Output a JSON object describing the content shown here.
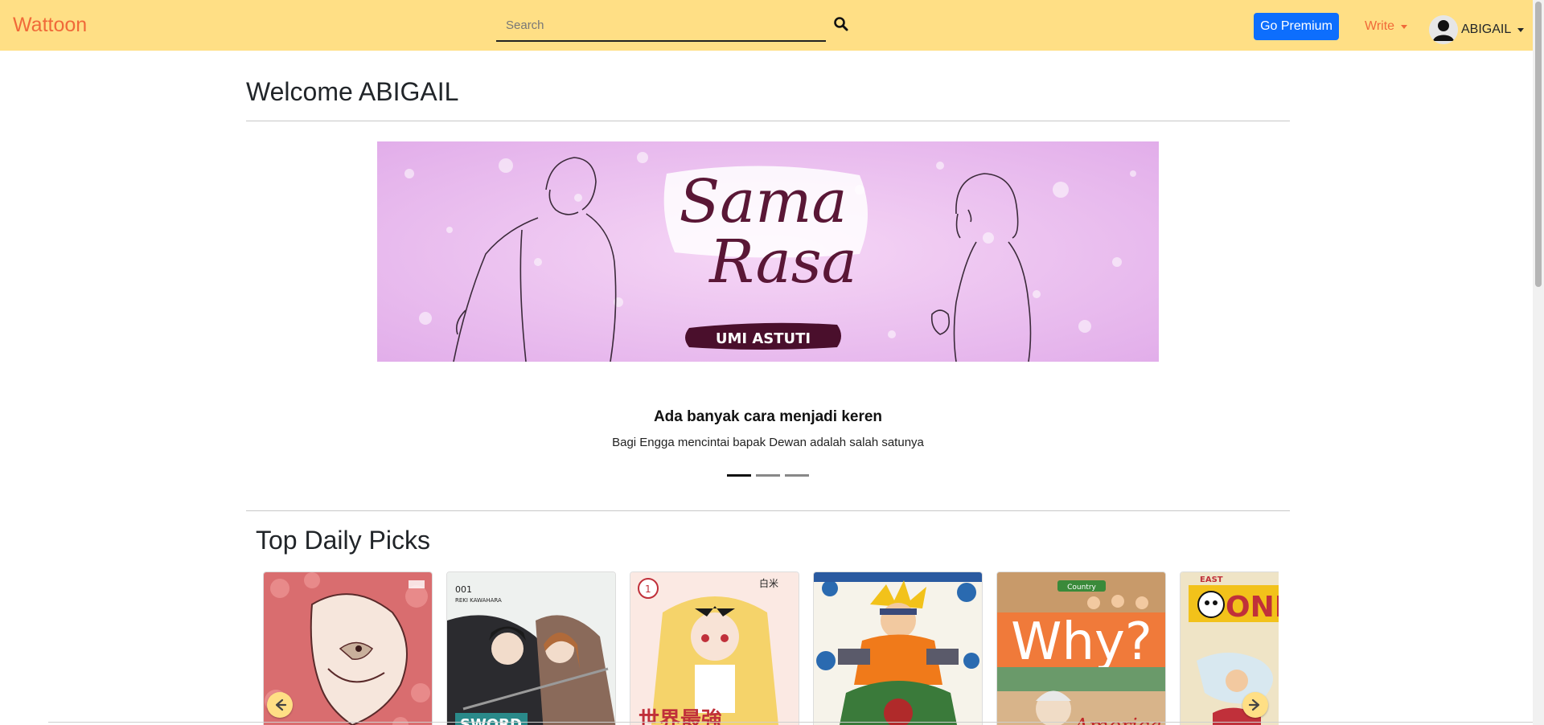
{
  "navbar": {
    "brand": "Wattoon",
    "search_placeholder": "Search",
    "premium_label": "Go Premium",
    "write_label": "Write",
    "user_name": "ABIGAIL"
  },
  "main": {
    "welcome": "Welcome ABIGAIL",
    "carousel": {
      "banner_title_line1": "Sama",
      "banner_title_line2": "Rasa",
      "banner_author": "UMI ASTUTI",
      "caption_title": "Ada banyak cara menjadi keren",
      "caption_text": "Bagi Engga mencintai bapak Dewan adalah salah satunya",
      "slides": 3,
      "active_slide": 0
    },
    "section_title": "Top Daily Picks",
    "picks": [
      {
        "id": "eagle",
        "cover_text": ""
      },
      {
        "id": "sword",
        "cover_text": "SWORD"
      },
      {
        "id": "arifureta",
        "cover_text": "世界最強"
      },
      {
        "id": "naruto",
        "cover_text": ""
      },
      {
        "id": "why",
        "cover_text": "Why?",
        "badge": "Country",
        "subtitle": "America"
      },
      {
        "id": "onepiece",
        "cover_text": "ONE P"
      }
    ]
  },
  "colors": {
    "navbar_bg": "#ffdf85",
    "brand": "#f06a39",
    "premium_bg": "#0d6efd",
    "banner_bg": "#e9b8ec"
  },
  "icons": {
    "search": "search-icon",
    "prev": "arrow-left-icon",
    "next": "arrow-right-icon",
    "avatar": "user-avatar-icon"
  }
}
